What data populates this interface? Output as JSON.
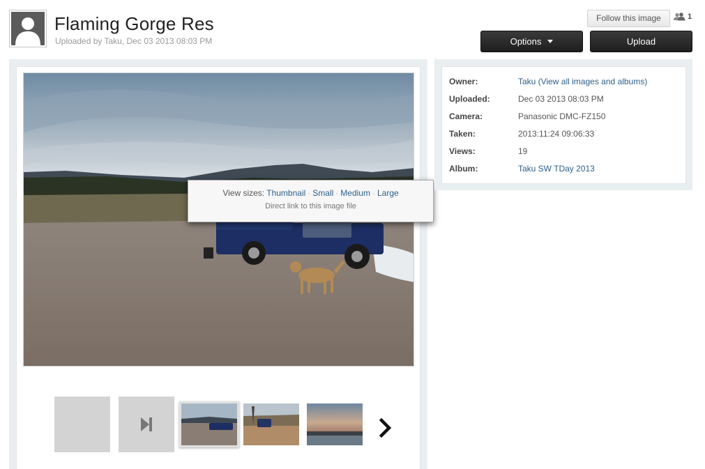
{
  "header": {
    "title": "Flaming Gorge Res",
    "subtitle": "Uploaded by Taku, Dec 03 2013 08:03 PM",
    "follow_label": "Follow this image",
    "follower_count": "1",
    "options_label": "Options",
    "upload_label": "Upload"
  },
  "popup": {
    "view_sizes_label": "View sizes:",
    "sizes": [
      "Thumbnail",
      "Small",
      "Medium",
      "Large"
    ],
    "direct_link": "Direct link to this image file"
  },
  "info": [
    {
      "label": "Owner:",
      "value": "Taku (View all images and albums)",
      "link": true
    },
    {
      "label": "Uploaded:",
      "value": "Dec 03 2013 08:03 PM",
      "link": false
    },
    {
      "label": "Camera:",
      "value": "Panasonic DMC-FZ150",
      "link": false
    },
    {
      "label": "Taken:",
      "value": "2013:11:24 09:06:33",
      "link": false
    },
    {
      "label": "Views:",
      "value": "19",
      "link": false
    },
    {
      "label": "Album:",
      "value": "Taku SW TDay 2013",
      "link": true
    }
  ],
  "icons": {
    "avatar": "default-user-silhouette",
    "followers": "users-icon",
    "options_caret": "caret-down-icon",
    "last": "skip-to-last-icon",
    "next": "chevron-right-icon"
  },
  "colors": {
    "link": "#2d5f8b",
    "dark_button": "#1e1e1e",
    "panel_border": "#e9eef1"
  }
}
